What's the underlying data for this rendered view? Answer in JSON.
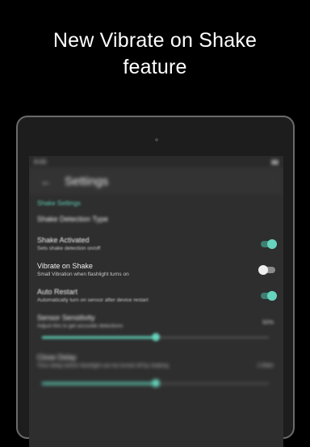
{
  "headline": {
    "line1": "New Vibrate on Shake",
    "line2": "feature"
  },
  "app": {
    "status_left": "8:00",
    "status_right": "▮▮",
    "toolbar_title": "Settings",
    "section_label": "Shake Settings",
    "items": [
      {
        "title": "Shake Detection Type",
        "subtitle": ""
      },
      {
        "title": "Shake Activated",
        "subtitle": "Sets shake detection on/off",
        "enabled": true
      },
      {
        "title": "Vibrate on Shake",
        "subtitle": "Small Vibration when flashlight turns on",
        "enabled": false
      },
      {
        "title": "Auto Restart",
        "subtitle": "Automatically turn on sensor after device restart",
        "enabled": true
      },
      {
        "title": "Sensor Sensitivity",
        "subtitle": "Adjust this to get accurate detections",
        "value": "50%",
        "level": 0.5
      },
      {
        "title": "Close Delay",
        "subtitle": "Time delay before flashlight can be turned off by shaking",
        "value": "1.0sec",
        "level": 0.5
      }
    ],
    "accent_color": "#5fcfb5"
  }
}
